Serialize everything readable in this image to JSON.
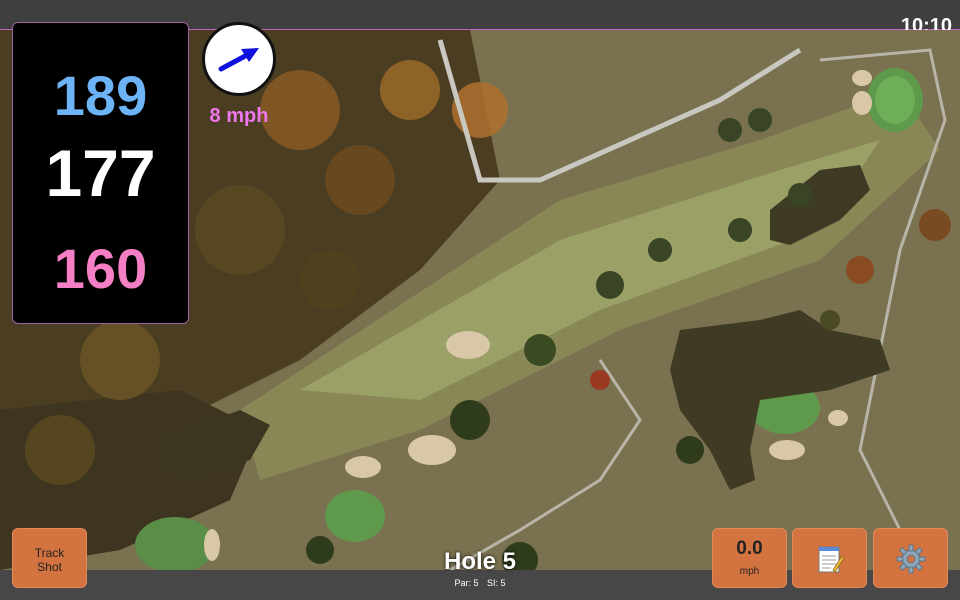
{
  "status": {
    "time": "10:10"
  },
  "distances": {
    "back": "189",
    "middle": "177",
    "front": "160"
  },
  "wind": {
    "speed": "8 mph",
    "icon": "wind-arrow-icon"
  },
  "hole": {
    "title": "Hole 5",
    "par": "Par: 5",
    "si": "SI: 5"
  },
  "buttons": {
    "track_shot_line1": "Track",
    "track_shot_line2": "Shot",
    "speed_value": "0.0",
    "speed_unit": "mph",
    "notes_icon": "notepad-icon",
    "settings_icon": "gear-icon"
  },
  "colors": {
    "back_distance": "#6cb4f6",
    "middle_distance": "#ffffff",
    "front_distance": "#f47fc4",
    "button": "#d3733f",
    "wind_text": "#ee77ee"
  }
}
